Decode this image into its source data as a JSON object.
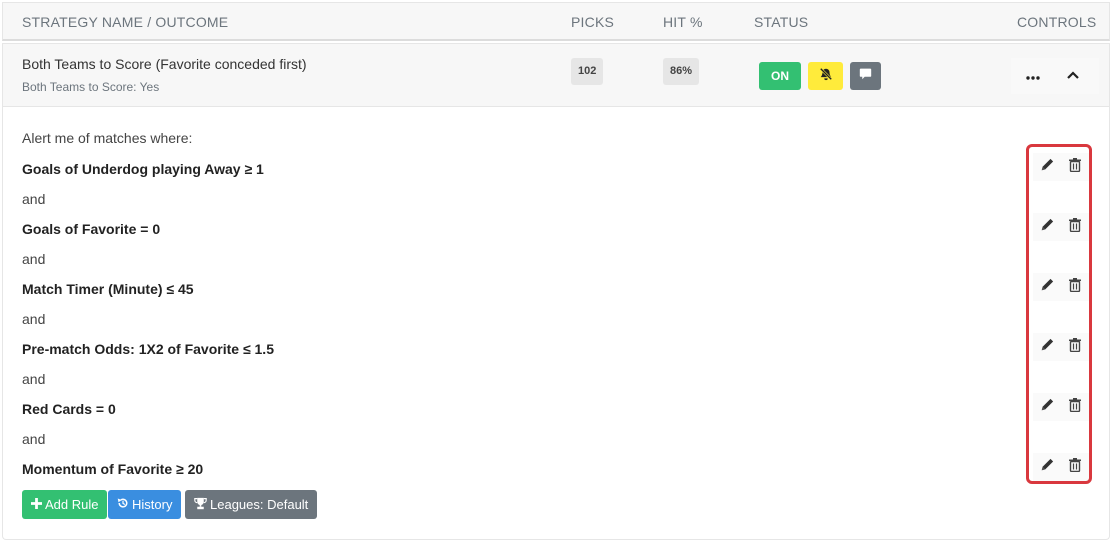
{
  "table_header": {
    "name_col": "STRATEGY NAME / OUTCOME",
    "picks_col": "PICKS",
    "hit_col": "HIT %",
    "status_col": "STATUS",
    "controls_col": "CONTROLS"
  },
  "strategy": {
    "name": "Both Teams to Score (Favorite conceded first)",
    "outcome": "Both Teams to Score: Yes",
    "picks": "102",
    "hit_percent": "86%",
    "status": {
      "on_label": "ON",
      "on_color": "#33c072",
      "bell_icon": "bell-slash-icon",
      "bell_color": "#ffeb3b",
      "chat_icon": "comment-icon",
      "chat_color": "#6c757d"
    },
    "controls": {
      "more_icon": "ellipsis-icon",
      "collapse_icon": "chevron-up-icon"
    }
  },
  "detail": {
    "intro": "Alert me of matches where:",
    "connector": "and",
    "rules": [
      "Goals of Underdog playing Away ≥ 1",
      "Goals of Favorite = 0",
      "Match Timer (Minute) ≤ 45",
      "Pre-match Odds: 1X2 of Favorite ≤ 1.5",
      "Red Cards = 0",
      "Momentum of Favorite ≥ 20"
    ],
    "rule_action_icons": [
      "pencil-icon",
      "trash-icon"
    ],
    "highlight_color": "#d9383e"
  },
  "actions": {
    "add_rule": "Add Rule",
    "history": "History",
    "leagues": "Leagues: Default"
  }
}
